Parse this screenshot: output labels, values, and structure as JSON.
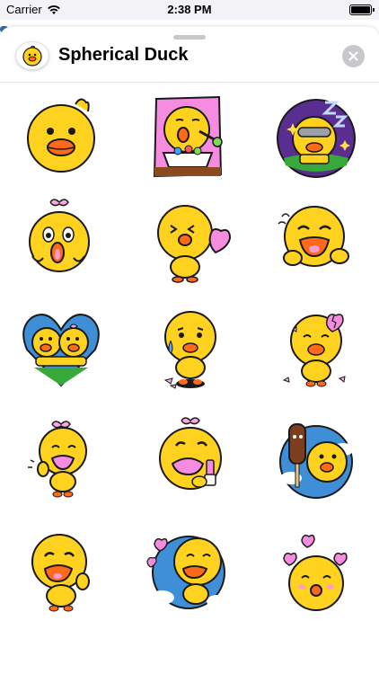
{
  "status_bar": {
    "carrier": "Carrier",
    "time": "2:38 PM"
  },
  "header": {
    "title": "Spherical Duck",
    "close_icon": "close-icon",
    "app_icon": "duck-app-icon"
  },
  "colors": {
    "duck_yellow": "#FFD21F",
    "beak_orange": "#FF6A1A",
    "outline": "#1a1a1a",
    "pink": "#FF9ACF",
    "blue": "#3F8FD8",
    "purple": "#5A2D91"
  },
  "stickers": [
    {
      "name": "sticker-duck-neutral",
      "icon": "duck-neutral"
    },
    {
      "name": "sticker-duck-eating",
      "icon": "duck-eating"
    },
    {
      "name": "sticker-duck-sleeping",
      "icon": "duck-sleeping"
    },
    {
      "name": "sticker-duck-shocked",
      "icon": "duck-shocked"
    },
    {
      "name": "sticker-duck-kiss",
      "icon": "duck-kiss"
    },
    {
      "name": "sticker-duck-laughing",
      "icon": "duck-laughing"
    },
    {
      "name": "sticker-duck-couple",
      "icon": "duck-couple"
    },
    {
      "name": "sticker-duck-crying",
      "icon": "duck-crying"
    },
    {
      "name": "sticker-duck-heartbroken",
      "icon": "duck-heartbroken"
    },
    {
      "name": "sticker-duck-waving",
      "icon": "duck-waving"
    },
    {
      "name": "sticker-duck-lipstick",
      "icon": "duck-lipstick"
    },
    {
      "name": "sticker-duck-icecream",
      "icon": "duck-icecream"
    },
    {
      "name": "sticker-duck-cheering",
      "icon": "duck-cheering"
    },
    {
      "name": "sticker-duck-love-sky",
      "icon": "duck-love-sky"
    },
    {
      "name": "sticker-duck-hearts",
      "icon": "duck-hearts"
    }
  ]
}
